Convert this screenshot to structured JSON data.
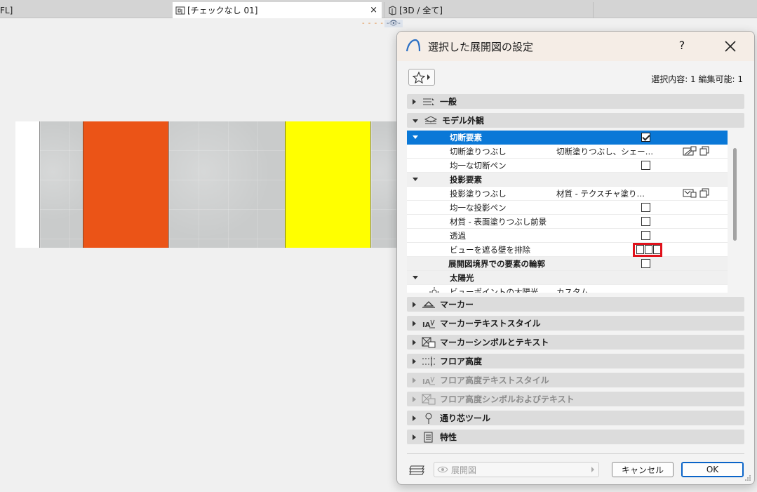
{
  "tabs": [
    {
      "label": "FL]"
    },
    {
      "label": "[チェックなし 01]",
      "close": "×"
    },
    {
      "label": "[3D / 全て]"
    }
  ],
  "subbar": {
    "left": "- - - -",
    "right": "-👁-"
  },
  "dialog": {
    "title": "選択した展開図の設定",
    "help": "?",
    "selection_info": "選択内容: 1 編集可能: 1",
    "sections_top": [
      {
        "label": "一般",
        "open": false,
        "icon": "general-settings-icon"
      },
      {
        "label": "モデル外観",
        "open": true,
        "icon": "model-appearance-icon"
      }
    ],
    "tree": [
      {
        "type": "selected",
        "label": "切断要素",
        "checked": true
      },
      {
        "type": "item",
        "label": "切断塗りつぶし",
        "value": "切断塗りつぶし、シェー…"
      },
      {
        "type": "item",
        "label": "均一な切断ペン",
        "checked": false
      },
      {
        "type": "group",
        "label": "投影要素"
      },
      {
        "type": "item",
        "label": "投影塗りつぶし",
        "value": "材質 - テクスチャ塗り…"
      },
      {
        "type": "item",
        "label": "均一な投影ペン",
        "checked": false
      },
      {
        "type": "item",
        "label": "材質 - 表面塗りつぶし前景",
        "checked": false
      },
      {
        "type": "item",
        "label": "透過",
        "checked": false
      },
      {
        "type": "item",
        "label": "ビューを遮る壁を排除"
      },
      {
        "type": "group-flat",
        "label": "展開図境界での要素の輪郭",
        "checked": false
      },
      {
        "type": "group",
        "label": "太陽光"
      },
      {
        "type": "item",
        "label": "ビューポイントの太陽光",
        "value": "カスタム"
      }
    ],
    "sections_bottom": [
      {
        "label": "マーカー",
        "icon": "marker-icon",
        "disabled": false
      },
      {
        "label": "マーカーテキストスタイル",
        "icon": "marker-text-style-icon",
        "disabled": false
      },
      {
        "label": "マーカーシンボルとテキスト",
        "icon": "marker-symbol-icon",
        "disabled": false
      },
      {
        "label": "フロア高度",
        "icon": "floor-level-icon",
        "disabled": false
      },
      {
        "label": "フロア高度テキストスタイル",
        "icon": "floor-level-text-icon",
        "disabled": true
      },
      {
        "label": "フロア高度シンボルおよびテキスト",
        "icon": "floor-level-symbol-icon",
        "disabled": true
      },
      {
        "label": "通り芯ツール",
        "icon": "grid-tool-icon",
        "disabled": false
      },
      {
        "label": "特性",
        "icon": "properties-icon",
        "disabled": false
      }
    ],
    "footer": {
      "view_select": "展開図",
      "cancel": "キャンセル",
      "ok": "OK"
    }
  },
  "colors": {
    "accent_selected": "#0a78d7",
    "highlight_box": "#e0111b",
    "wall_orange": "#eb5417",
    "wall_yellow": "#ffff00",
    "wall_concrete": "#c9cbcb"
  }
}
